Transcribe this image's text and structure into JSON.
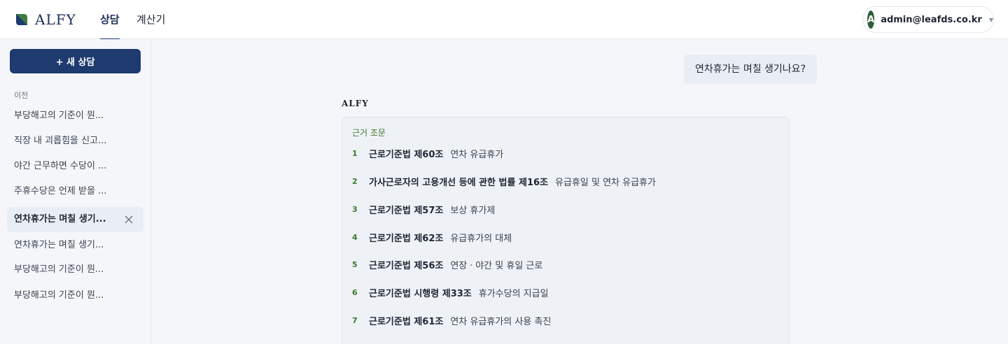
{
  "header": {
    "logo_text": "ALFY",
    "tabs": [
      {
        "label": "상담",
        "active": true
      },
      {
        "label": "계산기",
        "active": false
      }
    ],
    "user": {
      "avatar_initial": "A",
      "email": "admin@leafds.co.kr"
    }
  },
  "sidebar": {
    "new_chat_label": "+  새 상담",
    "section_label": "이전",
    "items": [
      {
        "label": "부당해고의 기준이 뭔..."
      },
      {
        "label": "직장 내 괴롭힘을 신고..."
      },
      {
        "label": "야간 근무하면 수당이 ..."
      },
      {
        "label": "주휴수당은 언제 받을 ..."
      },
      {
        "label": "연차휴가는 며칠 생기...",
        "active": true
      },
      {
        "label": "연차휴가는 며칠 생기..."
      },
      {
        "label": "부당해고의 기준이 뭔..."
      },
      {
        "label": "부당해고의 기준이 뭔..."
      }
    ]
  },
  "chat": {
    "user_message": "연차휴가는 며칠 생기나요?",
    "assistant_name": "ALFY",
    "citations_title": "근거 조문",
    "citations": [
      {
        "num": "1",
        "law": "근로기준법 제60조",
        "title": "연차 유급휴가"
      },
      {
        "num": "2",
        "law": "가사근로자의 고용개선 등에 관한 법률 제16조",
        "title": "유급휴일 및 연차 유급휴가"
      },
      {
        "num": "3",
        "law": "근로기준법 제57조",
        "title": "보상 휴가제"
      },
      {
        "num": "4",
        "law": "근로기준법 제62조",
        "title": "유급휴가의 대체"
      },
      {
        "num": "5",
        "law": "근로기준법 제56조",
        "title": "연장ㆍ야간 및 휴일 근로"
      },
      {
        "num": "6",
        "law": "근로기준법 시행령 제33조",
        "title": "휴가수당의 지급일"
      },
      {
        "num": "7",
        "law": "근로기준법 제61조",
        "title": "연차 유급휴가의 사용 촉진"
      }
    ]
  },
  "colors": {
    "primary": "#1e3a6e",
    "accent_green": "#3f7a2b",
    "avatar": "#2f5d3a"
  }
}
